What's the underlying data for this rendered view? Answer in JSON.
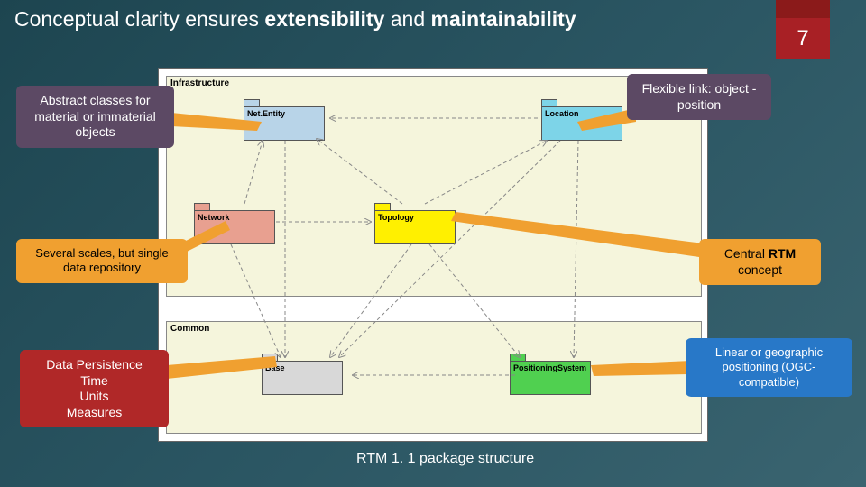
{
  "title_plain1": "Conceptual clarity ensures ",
  "title_bold1": "extensibility",
  "title_plain2": " and ",
  "title_bold2": "maintainability",
  "page_number": "7",
  "sections": {
    "infrastructure": "Infrastructure",
    "common": "Common"
  },
  "packages": {
    "netentity": "Net.Entity",
    "location": "Location",
    "network": "Network",
    "topology": "Topology",
    "base": "Base",
    "positioning": "PositioningSystem"
  },
  "callouts": {
    "abstract": "Abstract classes for material or immaterial objects",
    "flexible": "Flexible link: object - position",
    "scales": "Several scales, but single data repository",
    "central_l1": "Central ",
    "central_l2": "RTM",
    "central_l3": " concept",
    "persist_l1": "Data Persistence",
    "persist_l2": "Time",
    "persist_l3": "Units",
    "persist_l4": "Measures",
    "linear": "Linear or geographic positioning (OGC-compatible)"
  },
  "caption": "RTM 1. 1 package structure"
}
